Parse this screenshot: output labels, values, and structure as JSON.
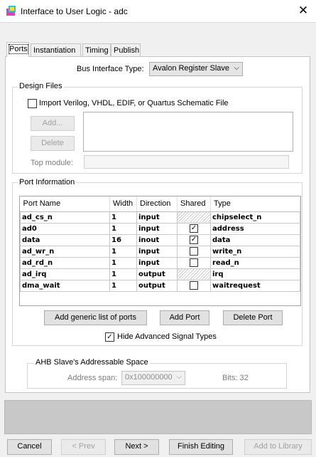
{
  "window": {
    "title": "Interface to User Logic - adc",
    "close_glyph": "✕"
  },
  "tabs": [
    {
      "label": "Ports",
      "active": true
    },
    {
      "label": "Instantiation",
      "active": false
    },
    {
      "label": "Timing",
      "active": false
    },
    {
      "label": "Publish",
      "active": false
    }
  ],
  "bus_interface": {
    "label": "Bus Interface Type:",
    "value": "Avalon Register Slave"
  },
  "design_files": {
    "title": "Design Files",
    "import_label": "Import Verilog, VHDL, EDIF, or Quartus Schematic File",
    "import_checked": false,
    "add_label": "Add...",
    "delete_label": "Delete",
    "top_module_label": "Top module:",
    "top_module_value": ""
  },
  "port_info": {
    "title": "Port Information",
    "columns": [
      "Port Name",
      "Width",
      "Direction",
      "Shared",
      "Type"
    ],
    "rows": [
      {
        "name": "ad_cs_n",
        "width": "1",
        "direction": "input",
        "shared": "disabled",
        "type": "chipselect_n"
      },
      {
        "name": "ad0",
        "width": "1",
        "direction": "input",
        "shared": "checked",
        "type": "address"
      },
      {
        "name": "data",
        "width": "16",
        "direction": "inout",
        "shared": "checked",
        "type": "data"
      },
      {
        "name": "ad_wr_n",
        "width": "1",
        "direction": "input",
        "shared": "unchecked",
        "type": "write_n"
      },
      {
        "name": "ad_rd_n",
        "width": "1",
        "direction": "input",
        "shared": "unchecked",
        "type": "read_n"
      },
      {
        "name": "ad_irq",
        "width": "1",
        "direction": "output",
        "shared": "disabled",
        "type": "irq"
      },
      {
        "name": "dma_wait",
        "width": "1",
        "direction": "output",
        "shared": "unchecked",
        "type": "waitrequest"
      }
    ],
    "add_generic_label": "Add generic list of ports",
    "add_port_label": "Add Port",
    "delete_port_label": "Delete Port",
    "hide_advanced_label": "Hide Advanced Signal Types",
    "hide_advanced_checked": true
  },
  "ahb": {
    "title": "AHB Slave's Addressable Space",
    "address_span_label": "Address span:",
    "address_span_value": "0x100000000",
    "bits_label": "Bits: 32"
  },
  "footer": {
    "cancel": "Cancel",
    "prev": "< Prev",
    "next": "Next >",
    "finish": "Finish Editing",
    "add_library": "Add to Library"
  },
  "icons": {
    "check": "✓",
    "chevron": "⌵"
  }
}
